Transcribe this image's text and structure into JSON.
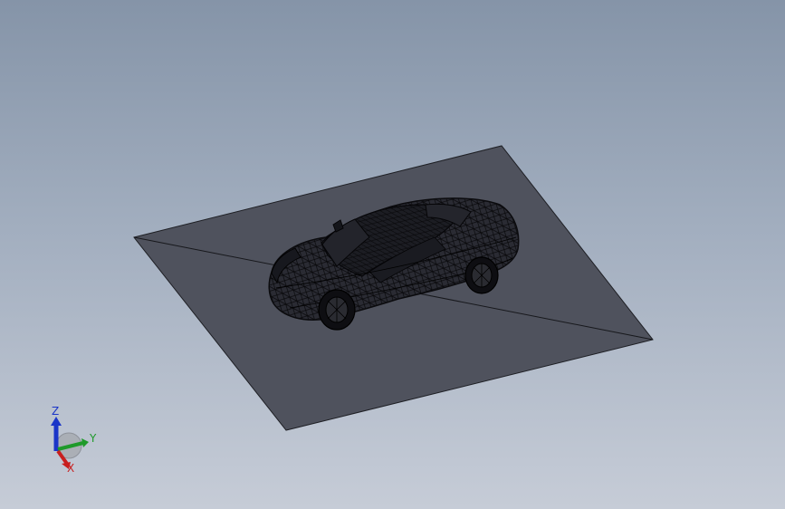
{
  "viewport": {
    "name": "3D model view",
    "background_top": "#8594a8",
    "background_bottom": "#c6ccd7"
  },
  "model": {
    "plane_color": "#4f525d",
    "edge_color": "#1e1f24",
    "mesh_color": "#0d0d10"
  },
  "triad": {
    "z_label": "Z",
    "y_label": "Y",
    "x_label": "X",
    "z_color": "#1a35c8",
    "y_color": "#1f9a2a",
    "x_color": "#c81e1e"
  }
}
